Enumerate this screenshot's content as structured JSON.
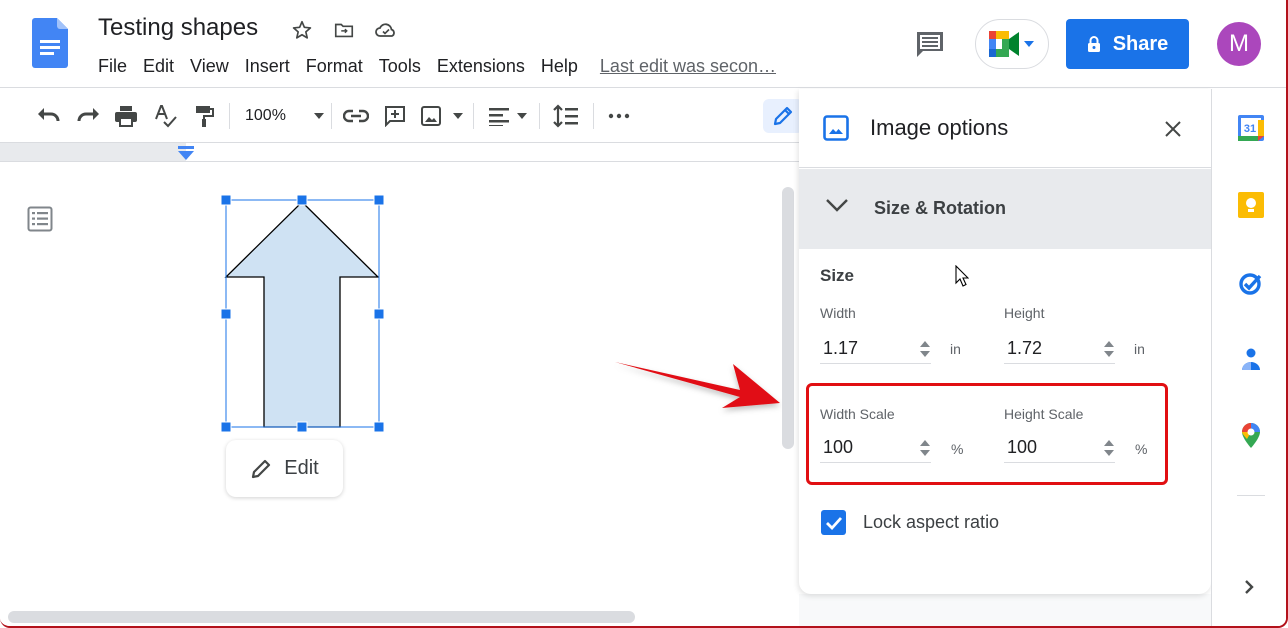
{
  "header": {
    "doc_title": "Testing shapes",
    "menu": [
      "File",
      "Edit",
      "View",
      "Insert",
      "Format",
      "Tools",
      "Extensions",
      "Help"
    ],
    "last_edit": "Last edit was secon…",
    "share_label": "Share",
    "avatar_initial": "M"
  },
  "toolbar": {
    "zoom_level": "100%"
  },
  "canvas": {
    "edit_chip_label": "Edit",
    "shape_fill": "#cfe2f3"
  },
  "panel": {
    "title": "Image options",
    "section_title": "Size & Rotation",
    "size_heading": "Size",
    "width_label": "Width",
    "width_value": "1.17",
    "width_unit": "in",
    "height_label": "Height",
    "height_value": "1.72",
    "height_unit": "in",
    "width_scale_label": "Width Scale",
    "width_scale_value": "100",
    "width_scale_unit": "%",
    "height_scale_label": "Height Scale",
    "height_scale_value": "100",
    "height_scale_unit": "%",
    "lock_aspect_label": "Lock aspect ratio",
    "lock_aspect_checked": true
  },
  "colors": {
    "accent": "#1a73e8",
    "highlight": "#e10f12",
    "avatar": "#ab47bc"
  },
  "rail": {
    "icons": [
      "calendar-icon",
      "keep-icon",
      "tasks-icon",
      "contacts-icon",
      "maps-icon"
    ],
    "calendar_day": "31"
  }
}
